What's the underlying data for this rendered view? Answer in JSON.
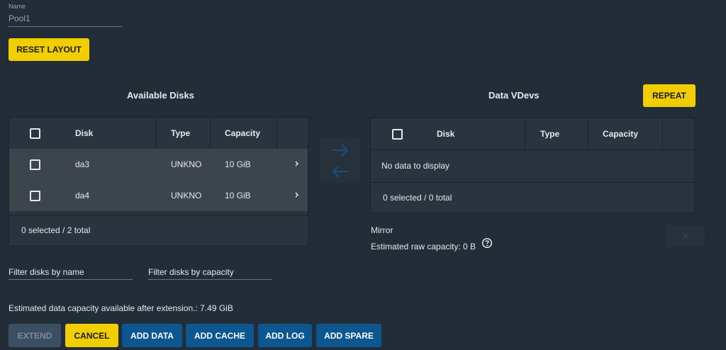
{
  "name_field": {
    "label": "Name",
    "value": "Pool1"
  },
  "reset_layout_label": "RESET LAYOUT",
  "available": {
    "title": "Available Disks",
    "columns": {
      "disk": "Disk",
      "type": "Type",
      "capacity": "Capacity"
    },
    "rows": [
      {
        "disk": "da3",
        "type": "UNKNO",
        "capacity": "10 GiB"
      },
      {
        "disk": "da4",
        "type": "UNKNO",
        "capacity": "10 GiB"
      }
    ],
    "footer": "0 selected / 2 total"
  },
  "vdevs": {
    "title": "Data VDevs",
    "repeat_label": "REPEAT",
    "columns": {
      "disk": "Disk",
      "type": "Type",
      "capacity": "Capacity"
    },
    "empty": "No data to display",
    "footer": "0 selected / 0 total",
    "layout": "Mirror",
    "raw_capacity": "Estimated raw capacity: 0 B",
    "remove_label": "X"
  },
  "filters": {
    "by_name": "Filter disks by name",
    "by_capacity": "Filter disks by capacity"
  },
  "estimated_capacity": "Estimated data capacity available after extension.: 7.49 GiB",
  "actions": {
    "extend": "EXTEND",
    "cancel": "CANCEL",
    "add_data": "ADD DATA",
    "add_cache": "ADD CACHE",
    "add_log": "ADD LOG",
    "add_spare": "ADD SPARE"
  },
  "icons": {
    "move_right": "arrow-right-icon",
    "move_left": "arrow-left-icon",
    "help": "help-circle-icon",
    "row_expand": "chevron-right-icon"
  },
  "colors": {
    "background": "#232d37",
    "primary_yellow": "#f0ce00",
    "primary_blue": "#0c578f",
    "panel": "#2a343e"
  }
}
